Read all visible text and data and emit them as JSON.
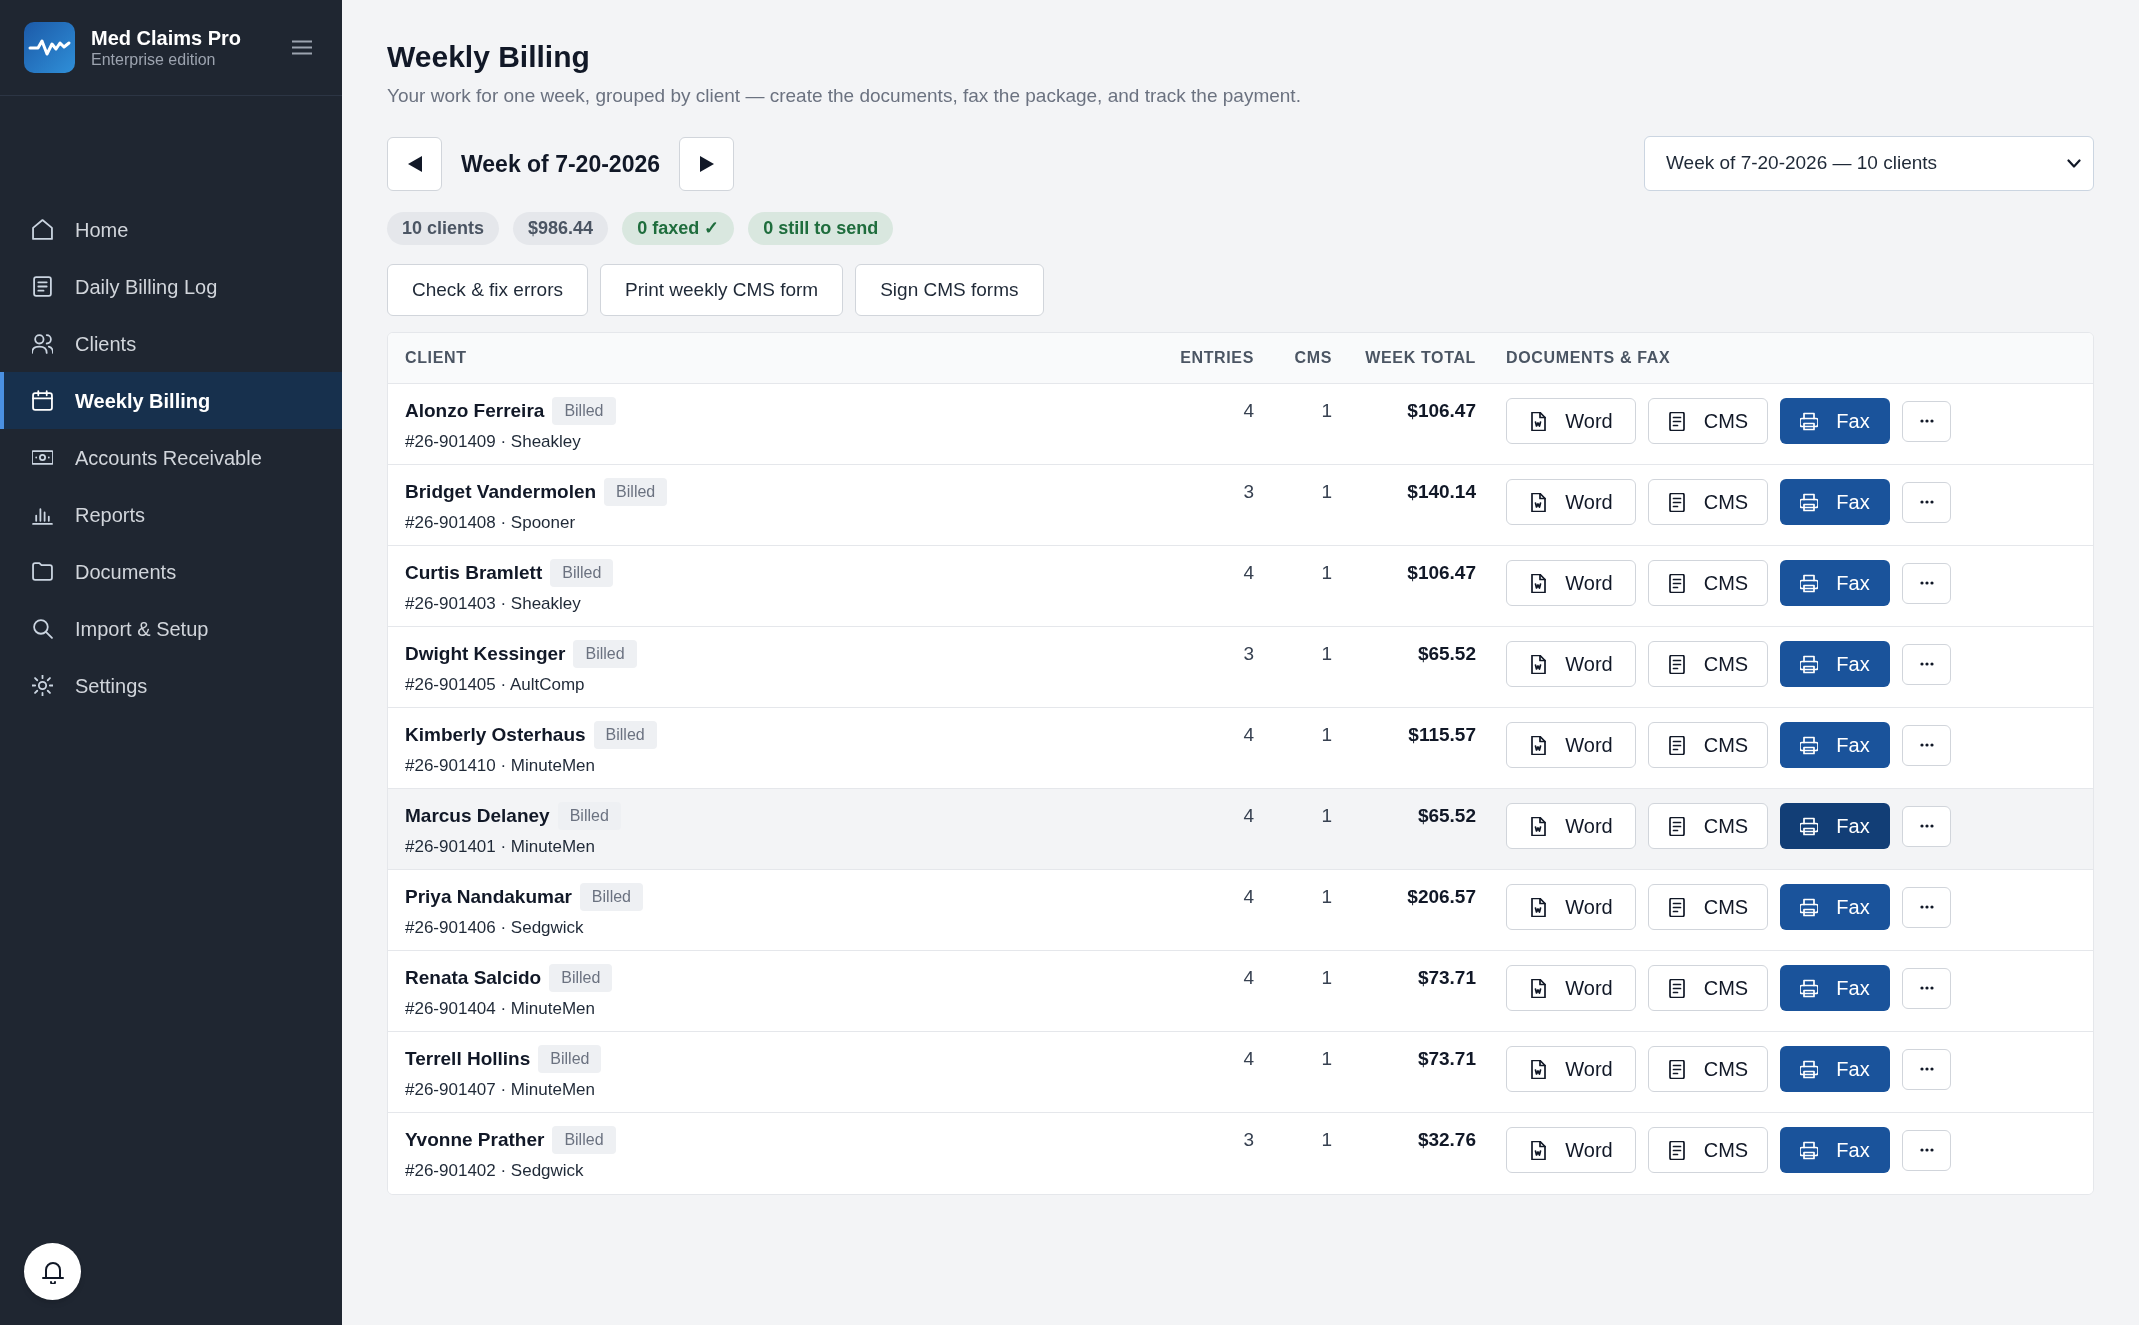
{
  "app": {
    "name": "Med Claims Pro",
    "edition": "Enterprise edition"
  },
  "sidebar": {
    "items": [
      {
        "label": "Home",
        "selected": false
      },
      {
        "label": "Daily Billing Log",
        "selected": false
      },
      {
        "label": "Clients",
        "selected": false
      },
      {
        "label": "Weekly Billing",
        "selected": true
      },
      {
        "label": "Accounts Receivable",
        "selected": false
      },
      {
        "label": "Reports",
        "selected": false
      },
      {
        "label": "Documents",
        "selected": false
      },
      {
        "label": "Import & Setup",
        "selected": false
      },
      {
        "label": "Settings",
        "selected": false
      }
    ]
  },
  "page": {
    "title": "Weekly Billing",
    "subtitle": "Your work for one week, grouped by client — create the documents, fax the package, and track the payment."
  },
  "week_nav": {
    "label": "Week of 7-20-2026"
  },
  "week_select": {
    "value": "Week of 7-20-2026 — 10 clients"
  },
  "summary_chips": [
    {
      "label": "10 clients",
      "kind": "neutral"
    },
    {
      "label": "$986.44",
      "kind": "neutral"
    },
    {
      "label": "0 faxed ✓",
      "kind": "success"
    },
    {
      "label": "0 still to send",
      "kind": "success"
    }
  ],
  "actions": [
    "Check & fix errors",
    "Print weekly CMS form",
    "Sign CMS forms"
  ],
  "table": {
    "columns": [
      "CLIENT",
      "ENTRIES",
      "CMS",
      "WEEK TOTAL",
      "DOCUMENTS & FAX"
    ],
    "rows": [
      {
        "name": "Alonzo Ferreira",
        "status": "Billed",
        "detail": "#26-901409 · Sheakley",
        "entries": "4",
        "cms": "1",
        "total": "$106.47",
        "highlighted": false,
        "documents": [
          {
            "kind": "word",
            "label": "Word"
          },
          {
            "kind": "cms",
            "label": "CMS"
          },
          {
            "kind": "fax",
            "label": "Fax"
          }
        ]
      },
      {
        "name": "Bridget Vandermolen",
        "status": "Billed",
        "detail": "#26-901408 · Spooner",
        "entries": "3",
        "cms": "1",
        "total": "$140.14",
        "highlighted": false,
        "documents": [
          {
            "kind": "word",
            "label": "Word"
          },
          {
            "kind": "cms",
            "label": "CMS"
          },
          {
            "kind": "fax",
            "label": "Fax"
          }
        ]
      },
      {
        "name": "Curtis Bramlett",
        "status": "Billed",
        "detail": "#26-901403 · Sheakley",
        "entries": "4",
        "cms": "1",
        "total": "$106.47",
        "highlighted": false,
        "documents": [
          {
            "kind": "word",
            "label": "Word"
          },
          {
            "kind": "cms",
            "label": "CMS"
          },
          {
            "kind": "fax",
            "label": "Fax"
          }
        ]
      },
      {
        "name": "Dwight Kessinger",
        "status": "Billed",
        "detail": "#26-901405 · AultComp",
        "entries": "3",
        "cms": "1",
        "total": "$65.52",
        "highlighted": false,
        "documents": [
          {
            "kind": "word",
            "label": "Word"
          },
          {
            "kind": "cms",
            "label": "CMS"
          },
          {
            "kind": "fax",
            "label": "Fax"
          }
        ]
      },
      {
        "name": "Kimberly Osterhaus",
        "status": "Billed",
        "detail": "#26-901410 · MinuteMen",
        "entries": "4",
        "cms": "1",
        "total": "$115.57",
        "highlighted": false,
        "documents": [
          {
            "kind": "word",
            "label": "Word"
          },
          {
            "kind": "cms",
            "label": "CMS"
          },
          {
            "kind": "fax",
            "label": "Fax"
          }
        ]
      },
      {
        "name": "Marcus Delaney",
        "status": "Billed",
        "detail": "#26-901401 · MinuteMen",
        "entries": "4",
        "cms": "1",
        "total": "$65.52",
        "highlighted": true,
        "documents": [
          {
            "kind": "word",
            "label": "Word"
          },
          {
            "kind": "cms",
            "label": "CMS"
          },
          {
            "kind": "fax",
            "label": "Fax"
          }
        ]
      },
      {
        "name": "Priya Nandakumar",
        "status": "Billed",
        "detail": "#26-901406 · Sedgwick",
        "entries": "4",
        "cms": "1",
        "total": "$206.57",
        "highlighted": false,
        "documents": [
          {
            "kind": "word",
            "label": "Word"
          },
          {
            "kind": "cms",
            "label": "CMS"
          },
          {
            "kind": "fax",
            "label": "Fax"
          }
        ]
      },
      {
        "name": "Renata Salcido",
        "status": "Billed",
        "detail": "#26-901404 · MinuteMen",
        "entries": "4",
        "cms": "1",
        "total": "$73.71",
        "highlighted": false,
        "documents": [
          {
            "kind": "word",
            "label": "Word"
          },
          {
            "kind": "cms",
            "label": "CMS"
          },
          {
            "kind": "fax",
            "label": "Fax"
          }
        ]
      },
      {
        "name": "Terrell Hollins",
        "status": "Billed",
        "detail": "#26-901407 · MinuteMen",
        "entries": "4",
        "cms": "1",
        "total": "$73.71",
        "highlighted": false,
        "documents": [
          {
            "kind": "word",
            "label": "Word"
          },
          {
            "kind": "cms",
            "label": "CMS"
          },
          {
            "kind": "fax",
            "label": "Fax"
          }
        ]
      },
      {
        "name": "Yvonne Prather",
        "status": "Billed",
        "detail": "#26-901402 · Sedgwick",
        "entries": "3",
        "cms": "1",
        "total": "$32.76",
        "highlighted": false,
        "documents": [
          {
            "kind": "word",
            "label": "Word"
          },
          {
            "kind": "cms",
            "label": "CMS"
          },
          {
            "kind": "fax",
            "label": "Fax"
          }
        ]
      }
    ]
  }
}
